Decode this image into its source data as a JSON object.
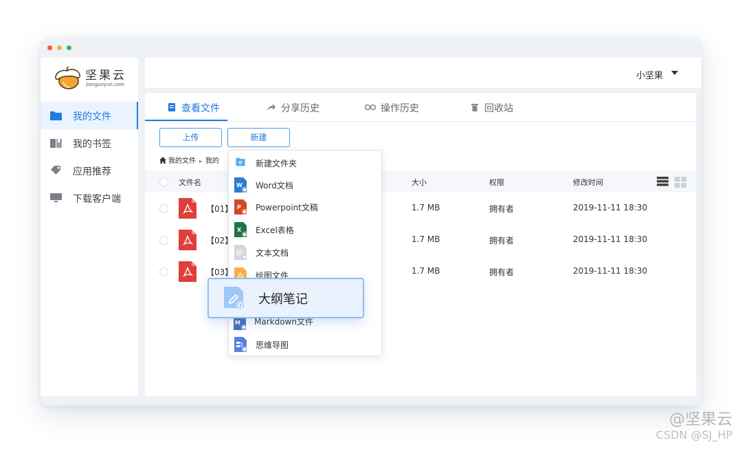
{
  "window": {
    "controls": [
      "close",
      "minimize",
      "maximize"
    ]
  },
  "brand": {
    "name": "坚果云",
    "domain": "jianguoyun.com",
    "logo_icon": "acorn-icon"
  },
  "sidebar": {
    "items": [
      {
        "label": "我的文件",
        "icon": "folder-icon",
        "active": true
      },
      {
        "label": "我的书签",
        "icon": "bookmark-icon",
        "active": false
      },
      {
        "label": "应用推荐",
        "icon": "tag-icon",
        "active": false
      },
      {
        "label": "下载客户端",
        "icon": "monitor-icon",
        "active": false
      }
    ]
  },
  "header": {
    "user_name": "小坚果"
  },
  "tabs": [
    {
      "label": "查看文件",
      "icon": "document-icon",
      "active": true
    },
    {
      "label": "分享历史",
      "icon": "share-icon",
      "active": false
    },
    {
      "label": "操作历史",
      "icon": "history-icon",
      "active": false
    },
    {
      "label": "回收站",
      "icon": "trash-icon",
      "active": false
    }
  ],
  "toolbar": {
    "upload_label": "上传",
    "new_label": "新建"
  },
  "breadcrumb": {
    "items": [
      "我的文件",
      "我的"
    ]
  },
  "table": {
    "headers": {
      "name": "文件名",
      "size": "大小",
      "permission": "权限",
      "modified": "修改时间"
    },
    "rows": [
      {
        "name": "【01】",
        "size": "1.7 MB",
        "permission": "拥有者",
        "modified": "2019-11-11  18:30",
        "icon": "pdf-icon"
      },
      {
        "name": "【02】",
        "size": "1.7 MB",
        "permission": "拥有者",
        "modified": "2019-11-11  18:30",
        "icon": "pdf-icon"
      },
      {
        "name": "【03】",
        "size": "1.7 MB",
        "permission": "拥有者",
        "modified": "2019-11-11  18:30",
        "icon": "pdf-icon"
      }
    ]
  },
  "new_menu": {
    "items": [
      {
        "label": "新建文件夹",
        "icon": "new-folder-icon"
      },
      {
        "label": "Word文档",
        "icon": "word-icon"
      },
      {
        "label": "Powerpoint文稿",
        "icon": "powerpoint-icon"
      },
      {
        "label": "Excel表格",
        "icon": "excel-icon"
      },
      {
        "label": "文本文档",
        "icon": "text-doc-icon"
      },
      {
        "label": "绘图文件",
        "icon": "drawing-icon"
      },
      {
        "label": "Markdown文件",
        "icon": "markdown-icon"
      },
      {
        "label": "思维导图",
        "icon": "mindmap-icon"
      }
    ],
    "highlighted": {
      "label": "大纲笔记",
      "icon": "outline-note-icon"
    }
  },
  "watermark": {
    "line1": "@坚果云",
    "line2": "CSDN @SJ_HP"
  },
  "colors": {
    "accent": "#1e7be0",
    "active_bg": "#eaf3ff",
    "highlight_bg": "#e9f2fd",
    "highlight_border": "#8fbdf0"
  }
}
